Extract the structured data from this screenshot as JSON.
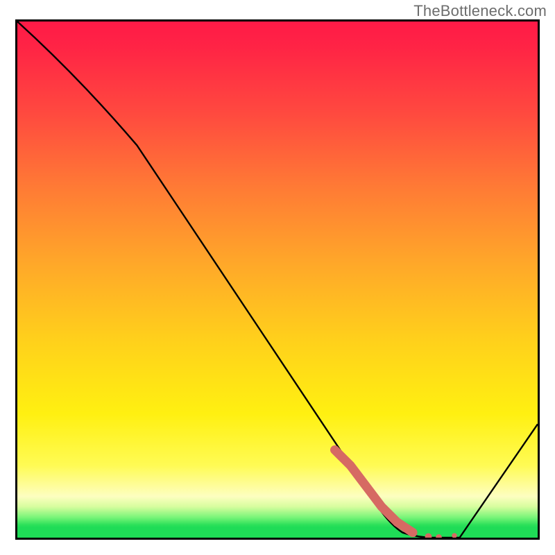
{
  "watermark": "TheBottleneck.com",
  "chart_data": {
    "type": "line",
    "title": "",
    "xlabel": "",
    "ylabel": "",
    "xlim": [
      0,
      100
    ],
    "ylim": [
      0,
      100
    ],
    "grid": false,
    "legend": false,
    "series": [
      {
        "name": "curve",
        "color": "#000000",
        "x": [
          0,
          23,
          68,
          74,
          80,
          85,
          100
        ],
        "y": [
          100,
          76,
          8,
          1,
          0,
          0,
          22
        ]
      },
      {
        "name": "highlight",
        "color": "#d66a63",
        "style": "thick-dashed",
        "x": [
          61,
          64,
          67,
          70,
          73,
          76,
          79,
          81,
          84
        ],
        "y": [
          17,
          14,
          10,
          6,
          3,
          1,
          0.2,
          0.1,
          0.4
        ]
      }
    ],
    "annotations": []
  }
}
